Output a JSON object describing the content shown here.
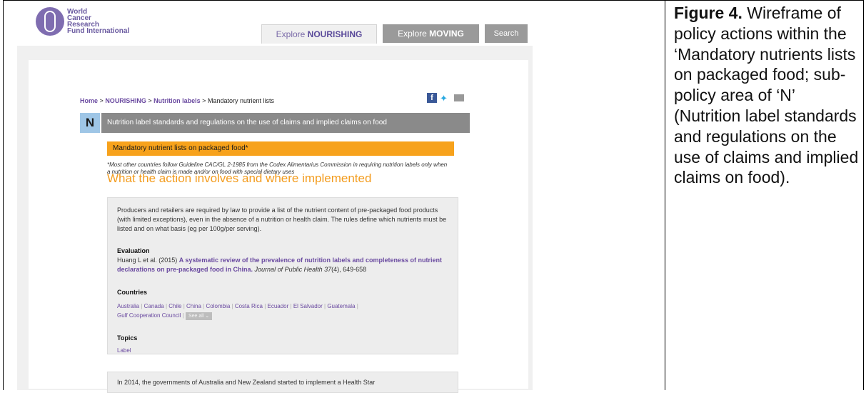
{
  "logo": {
    "line1": "World",
    "line2": "Cancer",
    "line3": "Research",
    "line4": "Fund International"
  },
  "nav": {
    "tab_nourishing_prefix": "Explore",
    "tab_nourishing_strong": "NOURISHING",
    "tab_moving_prefix": "Explore",
    "tab_moving_strong": "MOVING",
    "search_label": "Search"
  },
  "breadcrumb": {
    "home": "Home",
    "sep": ">",
    "nourishing": "NOURISHING",
    "nutrition_labels": "Nutrition labels",
    "current": "Mandatory nutrient lists"
  },
  "policy": {
    "letter": "N",
    "title": "Nutrition label standards and regulations on the use of claims and implied claims on food",
    "subtitle": "Mandatory nutrient lists on packaged food*",
    "footnote": "*Most other countries follow Guideline CAC/GL 2-1985 from the Codex Alimentarius Commission in requiring nutrition labels only when a nutrition or health claim is made and/or on food with special dietary uses",
    "heading": "What the action involves and where implemented"
  },
  "action": {
    "description": "Producers and retailers are required by law to provide a list of the nutrient content of pre-packaged food products (with limited exceptions), even in the absence of a nutrition or health claim. The rules define which nutrients must be listed and on what basis (eg per 100g/per serving).",
    "evaluation_heading": "Evaluation",
    "evaluation_authors": "Huang L et al. (2015)",
    "evaluation_title": "A systematic review of the prevalence of nutrition labels and completeness of nutrient declarations on pre-packaged food in China.",
    "evaluation_journal": "Journal of Public Health 37",
    "evaluation_issue": "(4), 649-658",
    "countries_heading": "Countries",
    "countries": [
      "Australia",
      "Canada",
      "Chile",
      "China",
      "Colombia",
      "Costa Rica",
      "Ecuador",
      "El Salvador",
      "Guatemala",
      "Gulf Cooperation Council"
    ],
    "see_all": "See all",
    "topics_heading": "Topics",
    "topic": "Label",
    "next_text": "In 2014, the governments of Australia and New Zealand started to implement a Health Star"
  },
  "caption": {
    "label": "Figure 4.",
    "text": "Wireframe of policy actions within the ‘Mandatory nutrients lists on packaged food; sub-policy area of ‘N’ (Nutrition label standards and regulations on the use of claims and implied claims on food)."
  },
  "colors": {
    "purple": "#6a4aa0",
    "orange": "#f7a21c",
    "heading_orange": "#f39c1e",
    "grey_bar": "#8a8a8a",
    "badge_blue": "#9fc6e6"
  }
}
